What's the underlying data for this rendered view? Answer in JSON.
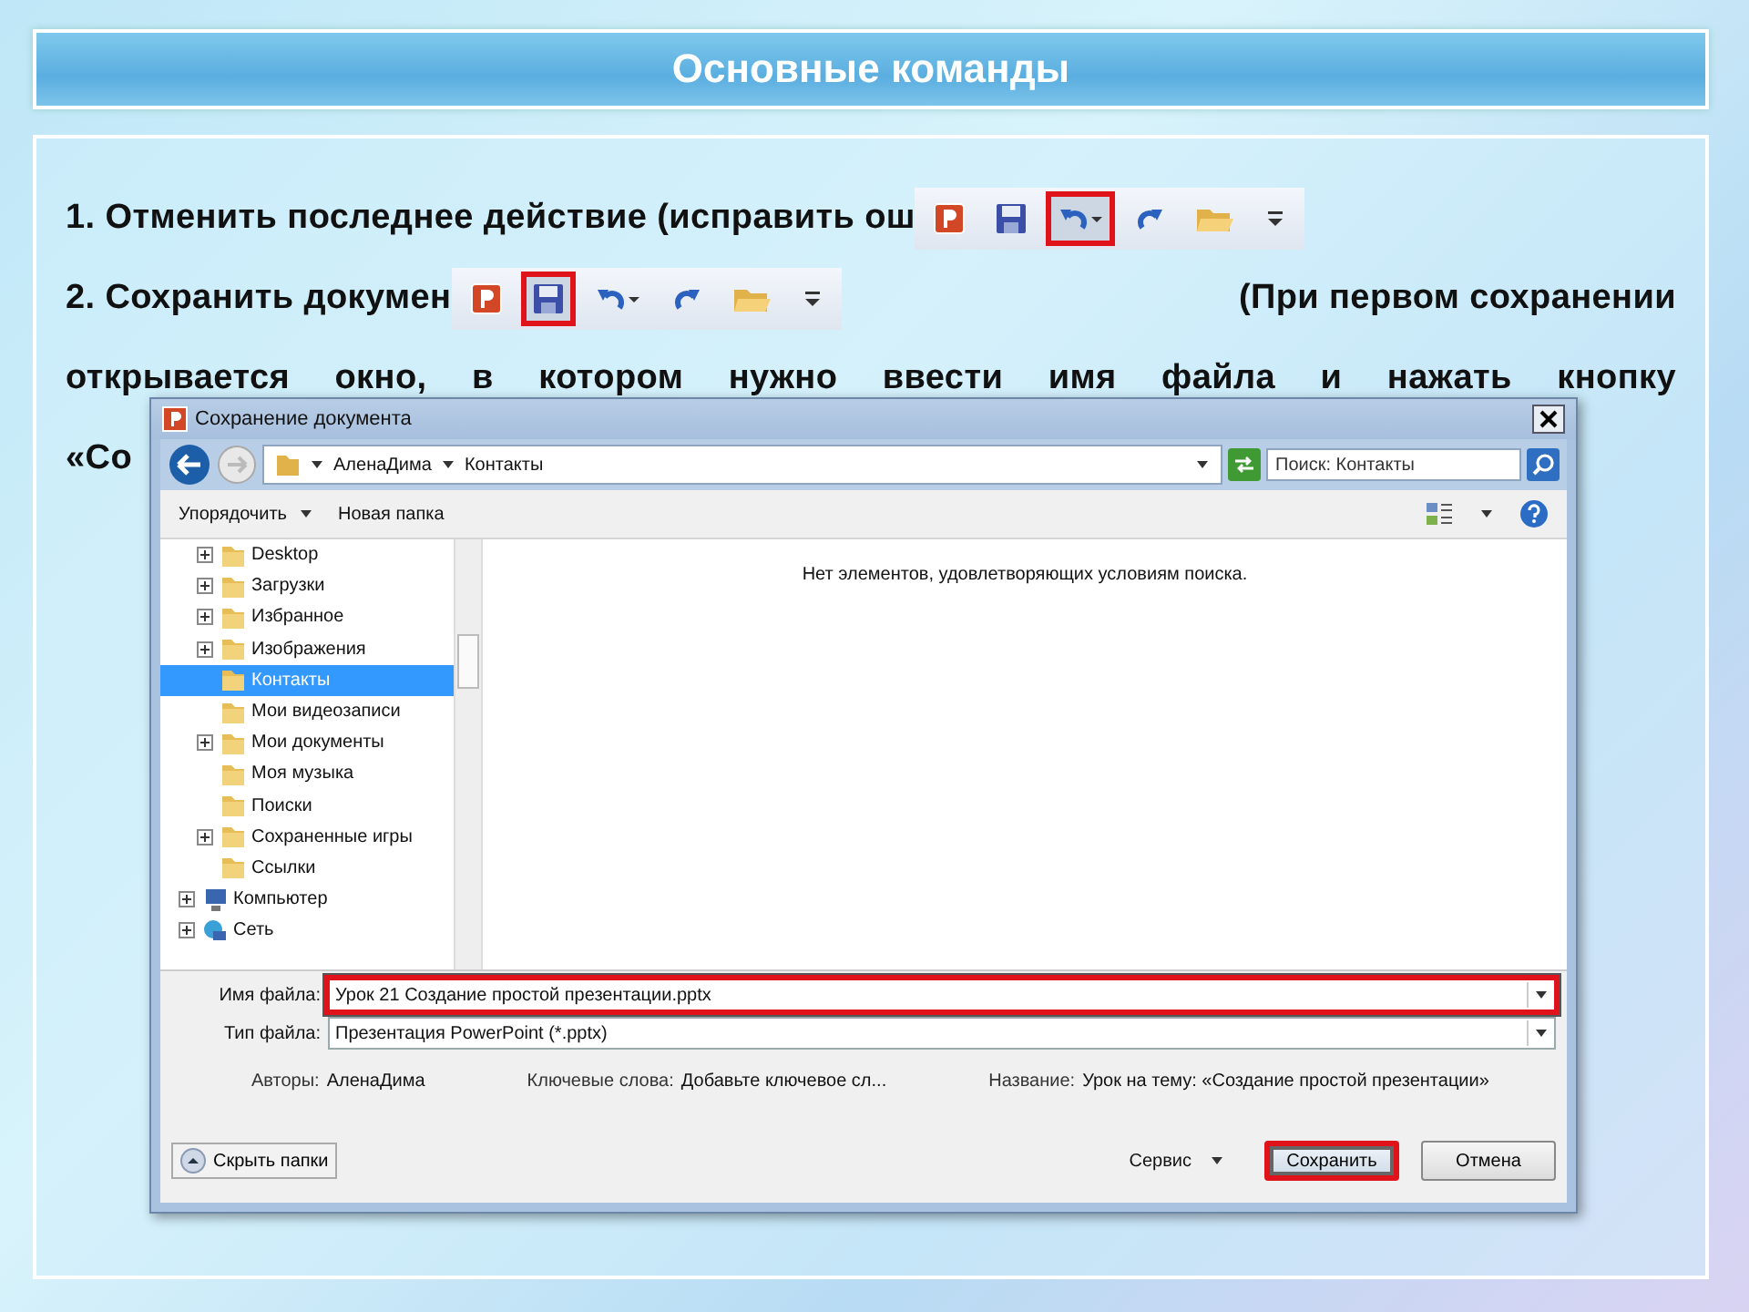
{
  "slide": {
    "title": "Основные команды",
    "lines": [
      {
        "kind": "toolbar_after",
        "text": "1. Отменить последнее действие (исправить ош",
        "toolbar": {
          "buttons": [
            {
              "kind": "app",
              "highlighted": false
            },
            {
              "kind": "save",
              "highlighted": false
            },
            {
              "kind": "undo",
              "highlighted": true
            },
            {
              "kind": "redo",
              "highlighted": false
            },
            {
              "kind": "open",
              "highlighted": false
            },
            {
              "kind": "customize",
              "highlighted": false
            }
          ]
        }
      },
      {
        "kind": "split",
        "text": "2. Сохранить докумен",
        "toolbar": {
          "buttons": [
            {
              "kind": "app",
              "highlighted": false
            },
            {
              "kind": "save",
              "highlighted": true
            },
            {
              "kind": "undo",
              "highlighted": false
            },
            {
              "kind": "redo",
              "highlighted": false
            },
            {
              "kind": "open",
              "highlighted": false
            },
            {
              "kind": "customize",
              "highlighted": false
            }
          ]
        },
        "tail": "(При первом сохранении"
      },
      {
        "kind": "justified",
        "text": "открывается окно, в котором нужно ввести имя файла и нажать кнопку"
      },
      {
        "kind": "plain",
        "text": "«Со"
      }
    ]
  },
  "dialog": {
    "title": "Сохранение документа",
    "breadcrumbs": [
      "АленаДима",
      "Контакты"
    ],
    "search": {
      "placeholder": "Поиск: Контакты"
    },
    "commands": [
      {
        "label": "Упорядочить",
        "dropdown": true
      },
      {
        "label": "Новая папка",
        "dropdown": false
      }
    ],
    "tree": [
      {
        "label": "Desktop",
        "expandable": true,
        "selected": false
      },
      {
        "label": "Загрузки",
        "expandable": true,
        "selected": false
      },
      {
        "label": "Избранное",
        "expandable": true,
        "selected": false
      },
      {
        "label": "Изображения",
        "expandable": true,
        "selected": false
      },
      {
        "label": "Контакты",
        "expandable": false,
        "selected": true
      },
      {
        "label": "Мои видеозаписи",
        "expandable": false,
        "selected": false
      },
      {
        "label": "Мои документы",
        "expandable": true,
        "selected": false
      },
      {
        "label": "Моя музыка",
        "expandable": false,
        "selected": false
      },
      {
        "label": "Поиски",
        "expandable": false,
        "selected": false
      },
      {
        "label": "Сохраненные игры",
        "expandable": true,
        "selected": false
      },
      {
        "label": "Ссылки",
        "expandable": false,
        "selected": false
      }
    ],
    "tree_roots": [
      {
        "label": "Компьютер",
        "kind": "computer",
        "expandable": true,
        "selected": false
      },
      {
        "label": "Сеть",
        "kind": "network",
        "expandable": true,
        "selected": false
      }
    ],
    "empty_message": "Нет элементов, удовлетворяющих условиям поиска.",
    "fields": [
      {
        "label": "Имя файла:",
        "value": "Урок 21 Создание простой презентации.pptx",
        "highlighted": true
      },
      {
        "label": "Тип файла:",
        "value": "Презентация PowerPoint (*.pptx)",
        "highlighted": false
      }
    ],
    "meta": [
      {
        "label": "Авторы:",
        "value": "АленаДима"
      },
      {
        "label": "Ключевые слова:",
        "value": "Добавьте ключевое сл..."
      },
      {
        "label": "Название:",
        "value": "Урок на тему: «Создание простой презентации»"
      }
    ],
    "hide_folders": "Скрыть папки",
    "tools": "Сервис",
    "buttons": [
      {
        "label": "Сохранить",
        "highlighted": true
      },
      {
        "label": "Отмена",
        "highlighted": false
      }
    ]
  }
}
